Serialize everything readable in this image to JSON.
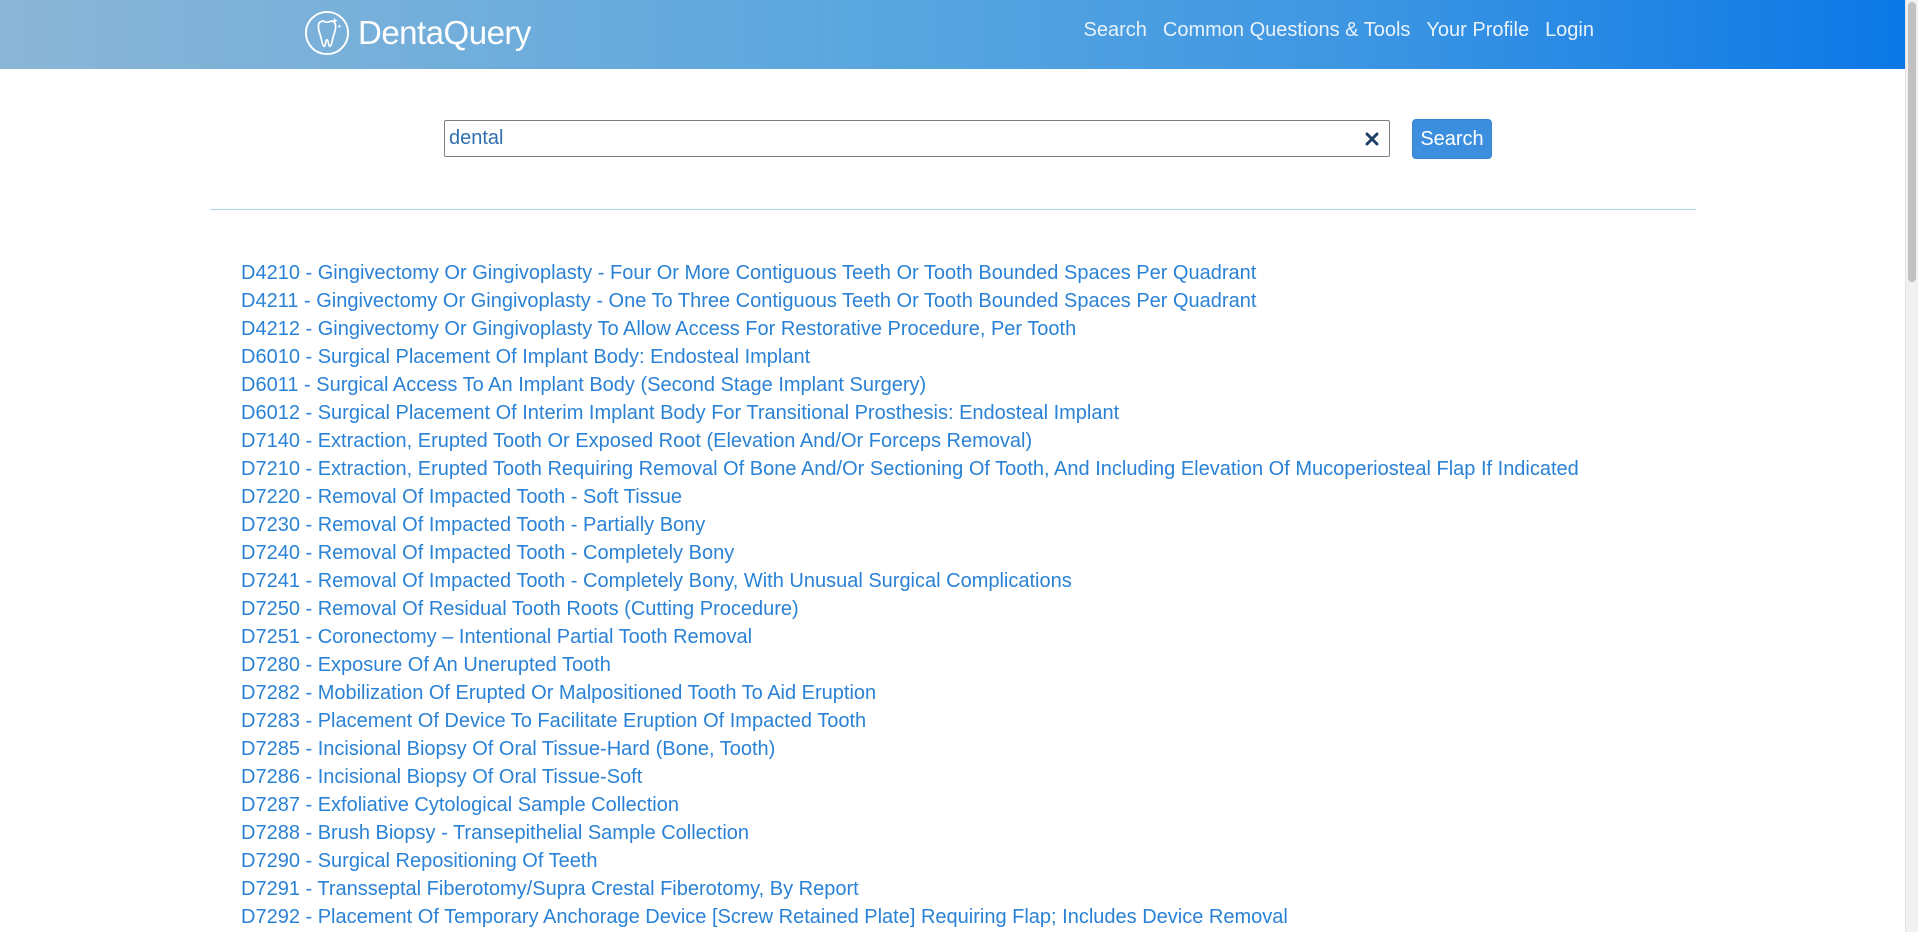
{
  "brand": {
    "name": "DentaQuery"
  },
  "nav": [
    {
      "label": "Search"
    },
    {
      "label": "Common Questions & Tools"
    },
    {
      "label": "Your Profile"
    },
    {
      "label": "Login"
    }
  ],
  "search": {
    "value": "dental",
    "button_label": "Search",
    "clear_icon": "close-icon"
  },
  "results": [
    "D4210 - Gingivectomy Or Gingivoplasty - Four Or More Contiguous Teeth Or Tooth Bounded Spaces Per Quadrant",
    "D4211 - Gingivectomy Or Gingivoplasty - One To Three Contiguous Teeth Or Tooth Bounded Spaces Per Quadrant",
    "D4212 - Gingivectomy Or Gingivoplasty To Allow Access For Restorative Procedure, Per Tooth",
    "D6010 - Surgical Placement Of Implant Body: Endosteal Implant",
    "D6011 - Surgical Access To An Implant Body (Second Stage Implant Surgery)",
    "D6012 - Surgical Placement Of Interim Implant Body For Transitional Prosthesis: Endosteal Implant",
    "D7140 - Extraction, Erupted Tooth Or Exposed Root (Elevation And/Or Forceps Removal)",
    "D7210 - Extraction, Erupted Tooth Requiring Removal Of Bone And/Or Sectioning Of Tooth, And Including Elevation Of Mucoperiosteal Flap If Indicated",
    "D7220 - Removal Of Impacted Tooth - Soft Tissue",
    "D7230 - Removal Of Impacted Tooth - Partially Bony",
    "D7240 - Removal Of Impacted Tooth - Completely Bony",
    "D7241 - Removal Of Impacted Tooth - Completely Bony, With Unusual Surgical Complications",
    "D7250 - Removal Of Residual Tooth Roots (Cutting Procedure)",
    "D7251 - Coronectomy – Intentional Partial Tooth Removal",
    "D7280 - Exposure Of An Unerupted Tooth",
    "D7282 - Mobilization Of Erupted Or Malpositioned Tooth To Aid Eruption",
    "D7283 - Placement Of Device To Facilitate Eruption Of Impacted Tooth",
    "D7285 - Incisional Biopsy Of Oral Tissue-Hard (Bone, Tooth)",
    "D7286 - Incisional Biopsy Of Oral Tissue-Soft",
    "D7287 - Exfoliative Cytological Sample Collection",
    "D7288 - Brush Biopsy - Transepithelial Sample Collection",
    "D7290 - Surgical Repositioning Of Teeth",
    "D7291 - Transseptal Fiberotomy/Supra Crestal Fiberotomy, By Report",
    "D7292 - Placement Of Temporary Anchorage Device [Screw Retained Plate] Requiring Flap; Includes Device Removal"
  ],
  "colors": {
    "link": "#2a82d6",
    "button": "#3c8fde",
    "navbar_start": "#8cb6d6",
    "navbar_end": "#0b78e6"
  }
}
